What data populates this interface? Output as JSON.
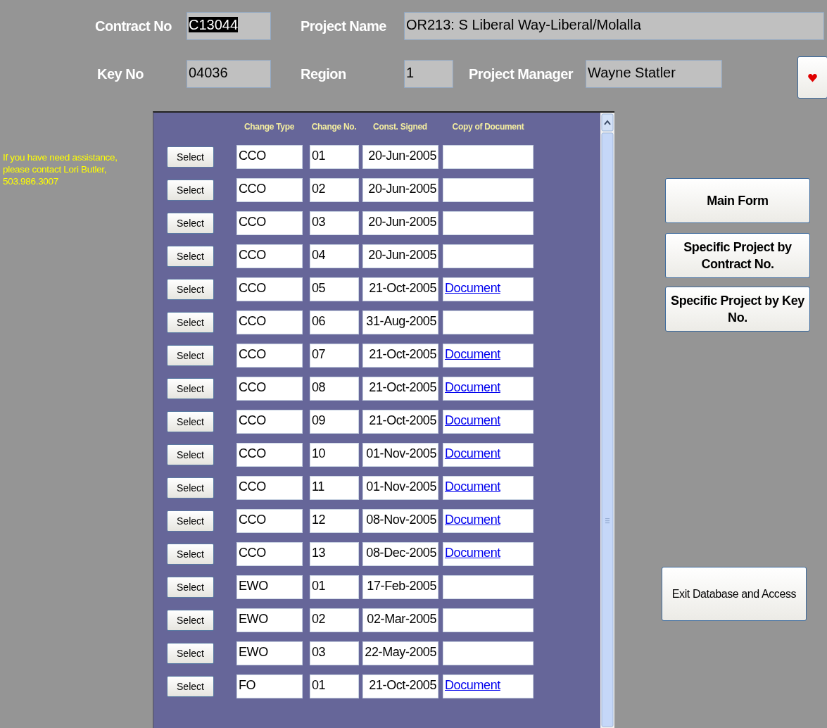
{
  "header": {
    "contract_no": {
      "label": "Contract No",
      "value": "C13044",
      "text_selected": true
    },
    "project_name": {
      "label": "Project Name",
      "value": "OR213: S Liberal Way-Liberal/Molalla"
    },
    "key_no": {
      "label": "Key No",
      "value": "04036"
    },
    "region": {
      "label": "Region",
      "value": "1"
    },
    "project_manager": {
      "label": "Project Manager",
      "value": "Wayne Statler"
    }
  },
  "help_text": "If you have need assistance, please contact Lori Butler, 503.986.3007",
  "table": {
    "columns": [
      "Change Type",
      "Change No.",
      "Const. Signed",
      "Copy of Document"
    ],
    "rows": [
      {
        "button": "Select",
        "change_type": "CCO",
        "change_no": "01",
        "const_signed": "20-Jun-2005"
      },
      {
        "button": "Select",
        "change_type": "CCO",
        "change_no": "02",
        "const_signed": "20-Jun-2005"
      },
      {
        "button": "Select",
        "change_type": "CCO",
        "change_no": "03",
        "const_signed": "20-Jun-2005"
      },
      {
        "button": "Select",
        "change_type": "CCO",
        "change_no": "04",
        "const_signed": "20-Jun-2005"
      },
      {
        "button": "Select",
        "change_type": "CCO",
        "change_no": "05",
        "const_signed": "21-Oct-2005",
        "document": "Document"
      },
      {
        "button": "Select",
        "change_type": "CCO",
        "change_no": "06",
        "const_signed": "31-Aug-2005"
      },
      {
        "button": "Select",
        "change_type": "CCO",
        "change_no": "07",
        "const_signed": "21-Oct-2005",
        "document": "Document"
      },
      {
        "button": "Select",
        "change_type": "CCO",
        "change_no": "08",
        "const_signed": "21-Oct-2005",
        "document": "Document"
      },
      {
        "button": "Select",
        "change_type": "CCO",
        "change_no": "09",
        "const_signed": "21-Oct-2005",
        "document": "Document"
      },
      {
        "button": "Select",
        "change_type": "CCO",
        "change_no": "10",
        "const_signed": "01-Nov-2005",
        "document": "Document"
      },
      {
        "button": "Select",
        "change_type": "CCO",
        "change_no": "11",
        "const_signed": "01-Nov-2005",
        "document": "Document"
      },
      {
        "button": "Select",
        "change_type": "CCO",
        "change_no": "12",
        "const_signed": "08-Nov-2005",
        "document": "Document"
      },
      {
        "button": "Select",
        "change_type": "CCO",
        "change_no": "13",
        "const_signed": "08-Dec-2005",
        "document": "Document"
      },
      {
        "button": "Select",
        "change_type": "EWO",
        "change_no": "01",
        "const_signed": "17-Feb-2005"
      },
      {
        "button": "Select",
        "change_type": "EWO",
        "change_no": "02",
        "const_signed": "02-Mar-2005"
      },
      {
        "button": "Select",
        "change_type": "EWO",
        "change_no": "03",
        "const_signed": "22-May-2005"
      },
      {
        "button": "Select",
        "change_type": "FO",
        "change_no": "01",
        "const_signed": "21-Oct-2005",
        "document": "Document"
      }
    ]
  },
  "nav_buttons": [
    "Main Form",
    "Specific Project by Contract No.",
    "Specific Project by Key No."
  ],
  "exit_button": "Exit Database and Access"
}
